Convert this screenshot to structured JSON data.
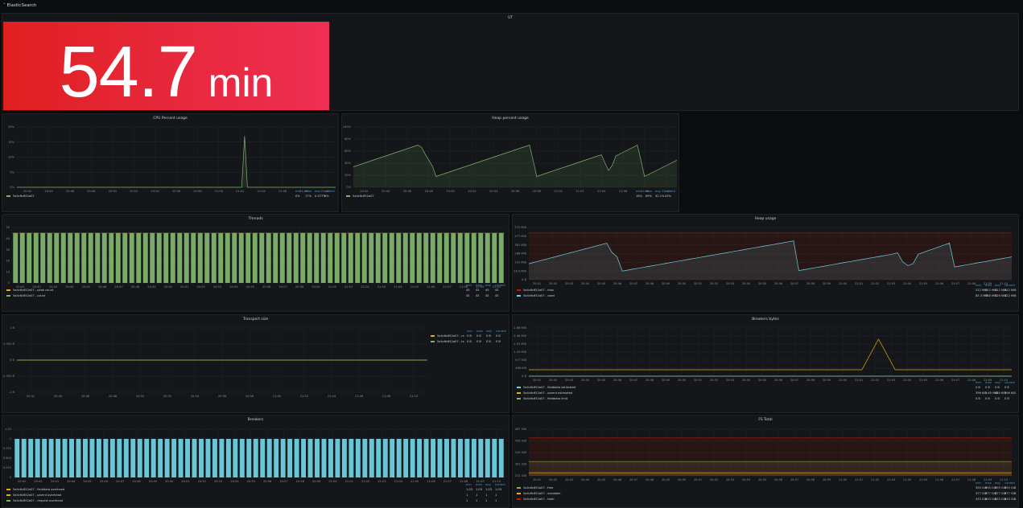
{
  "row": {
    "title": "ElasticSearch"
  },
  "uptime": {
    "title": "UT",
    "value": "54.7",
    "unit": "min"
  },
  "panels": {
    "cpu": {
      "title": "CPU Percent usage"
    },
    "heap_pct": {
      "title": "Heap percent usage"
    },
    "threads": {
      "title": "Threads"
    },
    "heap": {
      "title": "Heap usage"
    },
    "transport": {
      "title": "Transport size"
    },
    "breakers_bytes": {
      "title": "Breakers bytes"
    },
    "breakers": {
      "title": "Breakers"
    },
    "fs": {
      "title": "FS Total"
    }
  },
  "chart_data": [
    {
      "type": "line",
      "title": "CPU Percent usage",
      "x": [
        "20:42",
        "20:44",
        "20:46",
        "20:48",
        "20:50",
        "20:52",
        "20:54",
        "20:56",
        "20:58",
        "21:00",
        "21:02",
        "21:04",
        "21:06",
        "21:08",
        "21:10"
      ],
      "y_ticks": [
        "20%",
        "15%",
        "10%",
        "5%",
        "0%"
      ],
      "ylim": [
        0,
        20
      ],
      "series": [
        {
          "name": "5a4c6c652a07",
          "color": "#7eb26d",
          "values": [
            0,
            0,
            0,
            0,
            0,
            0,
            0,
            0,
            0,
            0,
            0,
            0,
            0,
            0,
            0,
            0,
            0,
            0,
            0,
            0,
            0,
            0,
            0,
            0,
            0,
            0,
            0,
            0,
            0,
            0,
            0,
            0,
            0,
            0,
            0,
            0,
            0,
            0,
            0,
            0,
            0,
            0,
            0,
            0,
            0,
            0,
            0,
            0,
            0,
            0,
            0,
            0,
            0,
            0,
            0,
            0,
            0,
            0,
            0,
            0,
            0,
            0,
            0,
            0,
            0,
            0,
            0,
            0,
            0,
            0,
            0,
            0,
            0,
            0,
            0,
            0,
            0,
            0,
            0,
            0,
            17,
            0,
            0,
            0,
            0,
            0,
            0,
            0,
            0,
            0,
            0,
            0,
            0,
            0,
            0,
            0,
            0,
            0,
            0,
            0,
            0,
            0,
            0,
            0,
            0,
            0,
            0,
            0,
            0,
            0,
            0,
            0,
            0
          ]
        }
      ],
      "legend": {
        "headers": [
          "min",
          "max",
          "avg",
          "current"
        ],
        "rows": [
          {
            "name": "5a4c6c652a07",
            "min": "0%",
            "max": "17%",
            "avg": "0.377%",
            "current": "0%"
          }
        ]
      }
    },
    {
      "type": "line",
      "title": "Heap percent usage",
      "x": [
        "20:42",
        "20:44",
        "20:46",
        "20:48",
        "20:50",
        "20:52",
        "20:54",
        "20:56",
        "20:58",
        "21:00",
        "21:02",
        "21:04",
        "21:06",
        "21:08",
        "21:10"
      ],
      "y_ticks": [
        "100%",
        "80%",
        "60%",
        "40%",
        "20%",
        "0%"
      ],
      "ylim": [
        0,
        100
      ],
      "series": [
        {
          "name": "5a4c6c652a07",
          "color": "#7eb26d",
          "values": [
            34,
            36,
            38,
            40,
            42,
            44,
            46,
            48,
            50,
            52,
            54,
            56,
            58,
            60,
            62,
            64,
            66,
            68,
            70,
            66,
            55,
            45,
            35,
            18,
            20,
            22,
            24,
            26,
            28,
            30,
            32,
            34,
            36,
            38,
            40,
            42,
            44,
            46,
            48,
            50,
            52,
            54,
            56,
            58,
            60,
            62,
            64,
            66,
            68,
            70,
            45,
            18,
            20,
            22,
            24,
            26,
            28,
            30,
            32,
            34,
            36,
            38,
            40,
            42,
            44,
            46,
            48,
            50,
            52,
            54,
            40,
            28,
            36,
            52,
            55,
            58,
            61,
            64,
            67,
            70,
            45,
            18,
            21,
            24,
            27,
            30,
            33,
            36,
            39,
            42,
            45
          ]
        }
      ],
      "legend": {
        "headers": [
          "min",
          "max",
          "avg",
          "current"
        ],
        "rows": [
          {
            "name": "5a4c6c652a07",
            "min": "16%",
            "max": "69%",
            "avg": "42.1%",
            "current": "43%"
          }
        ]
      }
    },
    {
      "type": "bar",
      "title": "Threads",
      "x": [
        "20:41",
        "20:42",
        "20:43",
        "20:44",
        "20:45",
        "20:46",
        "20:47",
        "20:48",
        "20:49",
        "20:50",
        "20:51",
        "20:52",
        "20:53",
        "20:54",
        "20:55",
        "20:56",
        "20:57",
        "20:58",
        "20:59",
        "21:00",
        "21:01",
        "21:02",
        "21:03",
        "21:04",
        "21:05",
        "21:06",
        "21:07",
        "21:08",
        "21:09",
        "21:10"
      ],
      "y_ticks": [
        "50",
        "40",
        "30",
        "20",
        "10",
        "0"
      ],
      "ylim": [
        0,
        50
      ],
      "bar_count": 72,
      "series": [
        {
          "name": "5a4c6c652a07 - peak count",
          "color": "#e5ac0e",
          "values": [
            45
          ]
        },
        {
          "name": "5a4c6c652a07 - count",
          "color": "#7eb26d",
          "values": [
            45
          ]
        }
      ],
      "legend": {
        "headers": [
          "min",
          "max",
          "avg",
          "current"
        ],
        "rows": [
          {
            "name": "5a4c6c652a07 - peak count",
            "min": "45",
            "max": "45",
            "avg": "45",
            "current": "45"
          },
          {
            "name": "5a4c6c652a07 - count",
            "min": "45",
            "max": "45",
            "avg": "45",
            "current": "45"
          }
        ]
      }
    },
    {
      "type": "line",
      "title": "Heap usage",
      "x": [
        "20:41",
        "20:42",
        "20:43",
        "20:44",
        "20:45",
        "20:46",
        "20:47",
        "20:48",
        "20:49",
        "20:50",
        "20:51",
        "20:52",
        "20:53",
        "20:54",
        "20:55",
        "20:56",
        "20:57",
        "20:58",
        "20:59",
        "21:00",
        "21:01",
        "21:02",
        "21:03",
        "21:04",
        "21:05",
        "21:06",
        "21:07",
        "21:08",
        "21:09",
        "21:10"
      ],
      "y_ticks": [
        "572 MiB",
        "477 MiB",
        "381 MiB",
        "286 MiB",
        "191 MiB",
        "95.4 MiB",
        "0 B"
      ],
      "series": [
        {
          "name": "5a4c6c652a07 - max",
          "color": "#bf1b00",
          "values": [
            512
          ]
        },
        {
          "name": "5a4c6c652a07 - used",
          "color": "#6ed0e0",
          "values": [
            175,
            190,
            205,
            220,
            235,
            250,
            265,
            280,
            295,
            310,
            325,
            340,
            355,
            370,
            385,
            400,
            300,
            250,
            95,
            105,
            115,
            125,
            135,
            145,
            155,
            165,
            175,
            185,
            195,
            205,
            215,
            225,
            235,
            245,
            255,
            265,
            275,
            285,
            295,
            305,
            315,
            325,
            335,
            345,
            355,
            365,
            375,
            385,
            395,
            405,
            415,
            425,
            100,
            110,
            120,
            130,
            140,
            150,
            160,
            170,
            180,
            190,
            200,
            210,
            220,
            230,
            240,
            250,
            260,
            270,
            280,
            295,
            195,
            155,
            175,
            280,
            300,
            320,
            340,
            360,
            380,
            400,
            140,
            150,
            160,
            170,
            180,
            190,
            200,
            210,
            220,
            230,
            240,
            250
          ]
        }
      ],
      "legend": {
        "headers": [
          "min",
          "max",
          "avg",
          "current"
        ],
        "rows": [
          {
            "name": "5a4c6c652a07 - max",
            "min": "512 MiB",
            "max": "512 MiB",
            "avg": "512 MiB",
            "current": "512 MiB"
          },
          {
            "name": "5a4c6c652a07 - used",
            "min": "85.3 MiB",
            "max": "358 MiB",
            "avg": "226 MiB",
            "current": "222 MiB"
          }
        ]
      }
    },
    {
      "type": "line",
      "title": "Transport size",
      "x": [
        "20:42",
        "20:44",
        "20:46",
        "20:48",
        "20:50",
        "20:52",
        "20:54",
        "20:56",
        "20:58",
        "21:00",
        "21:02",
        "21:04",
        "21:06",
        "21:08",
        "21:10"
      ],
      "y_ticks": [
        "1 B",
        "0.500 B",
        "0 B",
        "-0.500 B",
        "-1 B"
      ],
      "ylim": [
        -1,
        1
      ],
      "series": [
        {
          "name": "5a4c6c652a07 - rx",
          "color": "#e5ac0e",
          "values": [
            0
          ]
        },
        {
          "name": "5a4c6c652a07 - tx",
          "color": "#7eb26d",
          "values": [
            0
          ]
        }
      ],
      "legend": {
        "headers": [
          "min",
          "max",
          "avg",
          "current"
        ],
        "rows": [
          {
            "name": "5a4c6c652a07 - rx",
            "min": "0 B",
            "max": "0 B",
            "avg": "0 B",
            "current": "0 B"
          },
          {
            "name": "5a4c6c652a07 - tx",
            "min": "0 B",
            "max": "0 B",
            "avg": "0 B",
            "current": "0 B"
          }
        ]
      }
    },
    {
      "type": "line",
      "title": "Breakers bytes",
      "x": [
        "20:41",
        "20:42",
        "20:43",
        "20:44",
        "20:45",
        "20:46",
        "20:47",
        "20:48",
        "20:49",
        "20:50",
        "20:51",
        "20:52",
        "20:53",
        "20:54",
        "20:55",
        "20:56",
        "20:57",
        "20:58",
        "20:59",
        "21:00",
        "21:01",
        "21:02",
        "21:03",
        "21:04",
        "21:05",
        "21:06",
        "21:07",
        "21:08",
        "21:09",
        "21:10"
      ],
      "y_ticks": [
        "2.86 MiB",
        "2.38 MiB",
        "1.91 MiB",
        "1.43 MiB",
        "977 KiB",
        "488 KiB",
        "0 B"
      ],
      "series": [
        {
          "name": "5a4c6c652a07 - fielddata estimated",
          "color": "#6ed0e0",
          "values": [
            0
          ]
        },
        {
          "name": "5a4c6c652a07 - parent estimated",
          "color": "#e5ac0e",
          "values": [
            0.38,
            0.38,
            0.38,
            0.38,
            0.38,
            0.38,
            0.38,
            0.38,
            0.38,
            0.38,
            0.38,
            0.38,
            0.38,
            0.38,
            0.38,
            0.38,
            0.38,
            0.38,
            0.38,
            0.38,
            0.38,
            2.2,
            0.38,
            0.38,
            0.38,
            0.38,
            0.38,
            0.38,
            0.38,
            0.38
          ]
        },
        {
          "name": "5a4c6c652a07 - fielddata limit",
          "color": "#7eb26d",
          "values": [
            0
          ]
        }
      ],
      "legend": {
        "headers": [
          "min",
          "max",
          "avg",
          "current"
        ],
        "rows": [
          {
            "name": "5a4c6c652a07 - fielddata estimated",
            "min": "0 B",
            "max": "0 B",
            "avg": "0 B",
            "current": "0 B"
          },
          {
            "name": "5a4c6c652a07 - parent estimated",
            "min": "396 KiB",
            "max": "2.65 MiB",
            "avg": "465 KiB",
            "current": "396 KiB"
          },
          {
            "name": "5a4c6c652a07 - fielddata limit",
            "min": "0 B",
            "max": "0 B",
            "avg": "0 B",
            "current": "0 B"
          }
        ]
      }
    },
    {
      "type": "bar",
      "title": "Breakers",
      "x": [
        "20:41",
        "20:42",
        "20:43",
        "20:44",
        "20:45",
        "20:46",
        "20:47",
        "20:48",
        "20:49",
        "20:50",
        "20:51",
        "20:52",
        "20:53",
        "20:54",
        "20:55",
        "20:56",
        "20:57",
        "20:58",
        "20:59",
        "21:00",
        "21:01",
        "21:02",
        "21:03",
        "21:04",
        "21:05",
        "21:06",
        "21:07",
        "21:08",
        "21:09",
        "21:10"
      ],
      "y_ticks": [
        "1.25",
        "1",
        "0.750",
        "0.500",
        "0.250",
        "0"
      ],
      "ylim": [
        0,
        1.25
      ],
      "bar_count": 72,
      "series": [
        {
          "name": "5a4c6c652a07 - fielddata overhead",
          "color": "#6ed0e0",
          "values": [
            1
          ]
        }
      ],
      "legend": {
        "headers": [
          "min",
          "max",
          "avg",
          "current"
        ],
        "rows": [
          {
            "name": "5a4c6c652a07 - fielddata overhead",
            "min": "1.03",
            "max": "1.03",
            "avg": "1.03",
            "current": "1.03"
          },
          {
            "name": "5a4c6c652a07 - parent overhead",
            "min": "1",
            "max": "1",
            "avg": "1",
            "current": "1"
          },
          {
            "name": "5a4c6c652a07 - request overhead",
            "min": "1",
            "max": "1",
            "avg": "1",
            "current": "1"
          }
        ]
      }
    },
    {
      "type": "area",
      "title": "FS Total",
      "x": [
        "20:41",
        "20:42",
        "20:43",
        "20:44",
        "20:45",
        "20:46",
        "20:47",
        "20:48",
        "20:49",
        "20:50",
        "20:51",
        "20:52",
        "20:53",
        "20:54",
        "20:55",
        "20:56",
        "20:57",
        "20:58",
        "20:59",
        "21:00",
        "21:01",
        "21:02",
        "21:03",
        "21:04",
        "21:05",
        "21:06",
        "21:07",
        "21:08",
        "21:09",
        "21:10"
      ],
      "y_ticks": [
        "447 GiB",
        "428 GiB",
        "410 GiB",
        "391 GiB",
        "372 GiB"
      ],
      "series": [
        {
          "name": "5a4c6c652a07 - free",
          "color": "#7eb26d",
          "values": [
            395
          ]
        },
        {
          "name": "5a4c6c652a07 - available",
          "color": "#e5ac0e",
          "values": [
            377
          ]
        },
        {
          "name": "5a4c6c652a07 - total",
          "color": "#bf1b00",
          "values": [
            433
          ]
        }
      ],
      "legend": {
        "headers": [
          "min",
          "max",
          "avg",
          "current"
        ],
        "rows": [
          {
            "name": "5a4c6c652a07 - free",
            "min": "395 GiB",
            "max": "395 GiB",
            "avg": "395 GiB",
            "current": "395 GiB"
          },
          {
            "name": "5a4c6c652a07 - available",
            "min": "377 GiB",
            "max": "377 GiB",
            "avg": "377 GiB",
            "current": "377 GiB"
          },
          {
            "name": "5a4c6c652a07 - total",
            "min": "433 GiB",
            "max": "433 GiB",
            "avg": "433 GiB",
            "current": "433 GiB"
          }
        ]
      }
    }
  ]
}
